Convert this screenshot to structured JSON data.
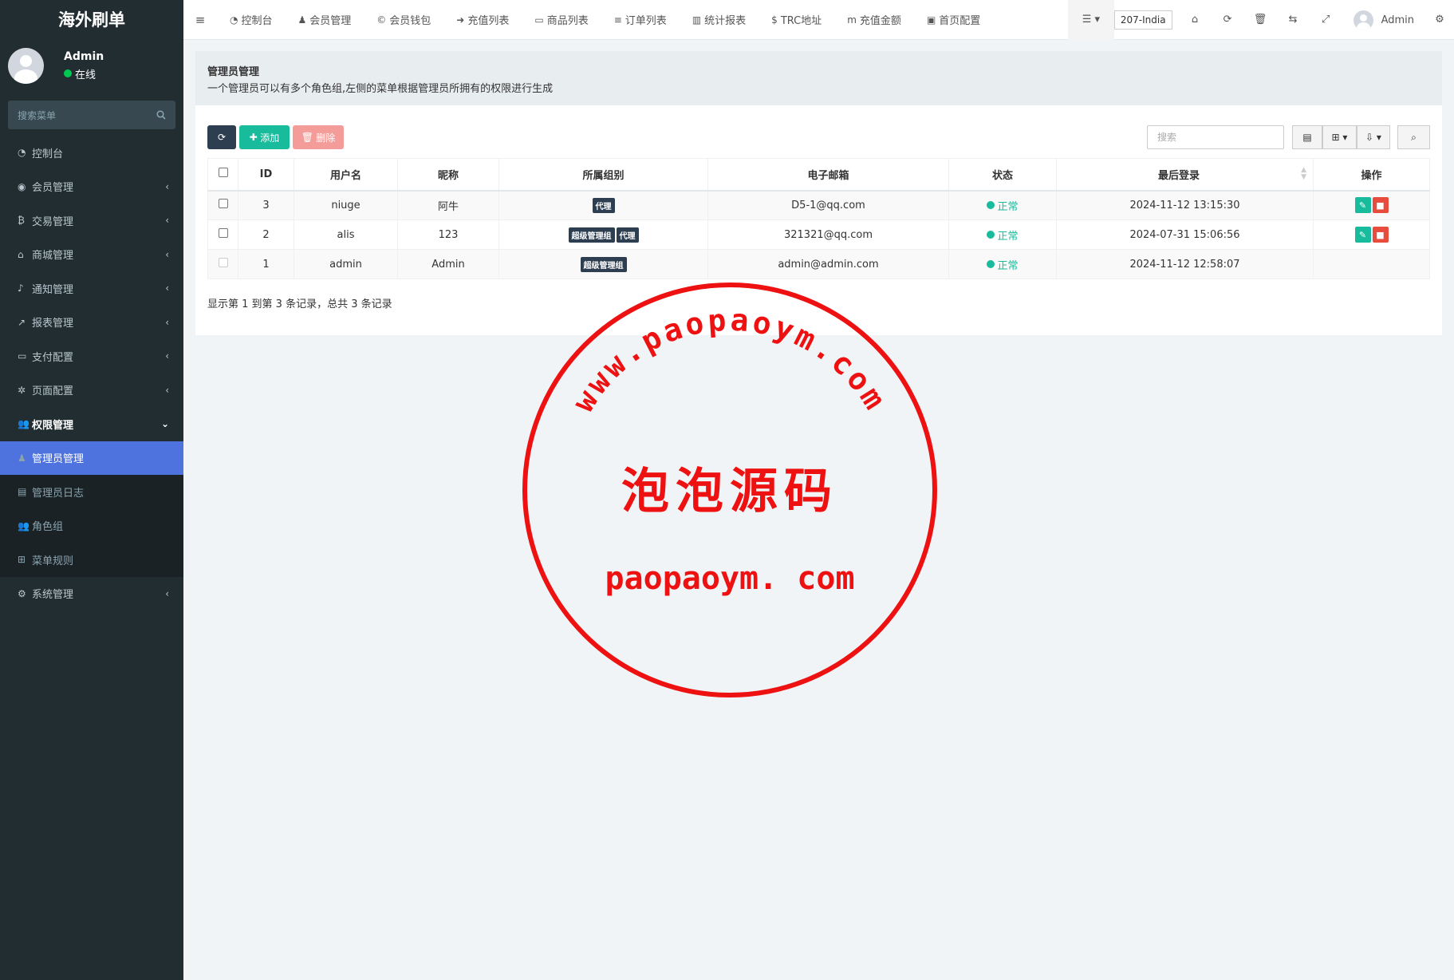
{
  "brand": "海外刷单",
  "user": {
    "name": "Admin",
    "status": "在线"
  },
  "sidebar": {
    "search_placeholder": "搜索菜单",
    "items": [
      {
        "label": "控制台",
        "icon": "dashboard-icon",
        "glyph": "◔",
        "arrow": ""
      },
      {
        "label": "会员管理",
        "icon": "user-circle-icon",
        "glyph": "◉",
        "arrow": "‹"
      },
      {
        "label": "交易管理",
        "icon": "bitcoin-icon",
        "glyph": "₿",
        "arrow": "‹"
      },
      {
        "label": "商城管理",
        "icon": "home-icon",
        "glyph": "⌂",
        "arrow": "‹"
      },
      {
        "label": "通知管理",
        "icon": "bell-icon",
        "glyph": "♪",
        "arrow": "‹"
      },
      {
        "label": "报表管理",
        "icon": "line-chart-icon",
        "glyph": "↗",
        "arrow": "‹"
      },
      {
        "label": "支付配置",
        "icon": "credit-card-icon",
        "glyph": "▭",
        "arrow": "‹"
      },
      {
        "label": "页面配置",
        "icon": "gear-icon",
        "glyph": "✲",
        "arrow": "‹"
      },
      {
        "label": "权限管理",
        "icon": "users-icon",
        "glyph": "👥",
        "arrow": "⌄"
      }
    ],
    "submenu": [
      {
        "label": "管理员管理",
        "icon": "user-icon",
        "glyph": "♟"
      },
      {
        "label": "管理员日志",
        "icon": "list-alt-icon",
        "glyph": "▤"
      },
      {
        "label": "角色组",
        "icon": "group-icon",
        "glyph": "👥"
      },
      {
        "label": "菜单规则",
        "icon": "windows-icon",
        "glyph": "⊞"
      }
    ],
    "last_item": {
      "label": "系统管理",
      "icon": "cogs-icon",
      "glyph": "⚙",
      "arrow": "‹"
    }
  },
  "topnav": {
    "links": [
      {
        "label": "控制台",
        "icon": "dashboard-icon",
        "glyph": "◔"
      },
      {
        "label": "会员管理",
        "icon": "user-icon",
        "glyph": "♟"
      },
      {
        "label": "会员钱包",
        "icon": "cc-icon",
        "glyph": "©"
      },
      {
        "label": "充值列表",
        "icon": "sign-in-icon",
        "glyph": "➜"
      },
      {
        "label": "商品列表",
        "icon": "desktop-icon",
        "glyph": "▭"
      },
      {
        "label": "订单列表",
        "icon": "list-icon",
        "glyph": "≡"
      },
      {
        "label": "统计报表",
        "icon": "bar-chart-icon",
        "glyph": "▥"
      },
      {
        "label": "TRC地址",
        "icon": "dollar-icon",
        "glyph": "$"
      },
      {
        "label": "充值金额",
        "icon": "money-icon",
        "glyph": "m"
      },
      {
        "label": "首页配置",
        "icon": "save-icon",
        "glyph": "▣"
      }
    ],
    "lang": "207-India",
    "admin_name": "Admin"
  },
  "page": {
    "title": "管理员管理",
    "description": "一个管理员可以有多个角色组,左侧的菜单根据管理员所拥有的权限进行生成"
  },
  "toolbar": {
    "add_label": "添加",
    "delete_label": "删除",
    "search_placeholder": "搜索"
  },
  "table": {
    "headers": [
      "ID",
      "用户名",
      "昵称",
      "所属组别",
      "电子邮箱",
      "状态",
      "最后登录",
      "操作"
    ],
    "rows": [
      {
        "id": "3",
        "username": "niuge",
        "nickname": "阿牛",
        "groups": [
          "代理"
        ],
        "email": "D5-1@qq.com",
        "status": "正常",
        "last_login": "2024-11-12 13:15:30",
        "has_actions": true
      },
      {
        "id": "2",
        "username": "alis",
        "nickname": "123",
        "groups": [
          "超级管理组",
          "代理"
        ],
        "email": "321321@qq.com",
        "status": "正常",
        "last_login": "2024-07-31 15:06:56",
        "has_actions": true
      },
      {
        "id": "1",
        "username": "admin",
        "nickname": "Admin",
        "groups": [
          "超级管理组"
        ],
        "email": "admin@admin.com",
        "status": "正常",
        "last_login": "2024-11-12 12:58:07",
        "has_actions": false
      }
    ]
  },
  "pagination_info": "显示第 1 到第 3 条记录，总共 3 条记录",
  "watermark": {
    "arc_text": "www.paopaoym.com",
    "center_text": "泡泡源码",
    "bottom_text": "paopaoym. com",
    "color": "#ee1111"
  },
  "colors": {
    "sidebar_bg": "#222d32",
    "active": "#4e73df",
    "green": "#18bc9c",
    "red": "#e74c3c",
    "dark": "#2c3e50"
  }
}
